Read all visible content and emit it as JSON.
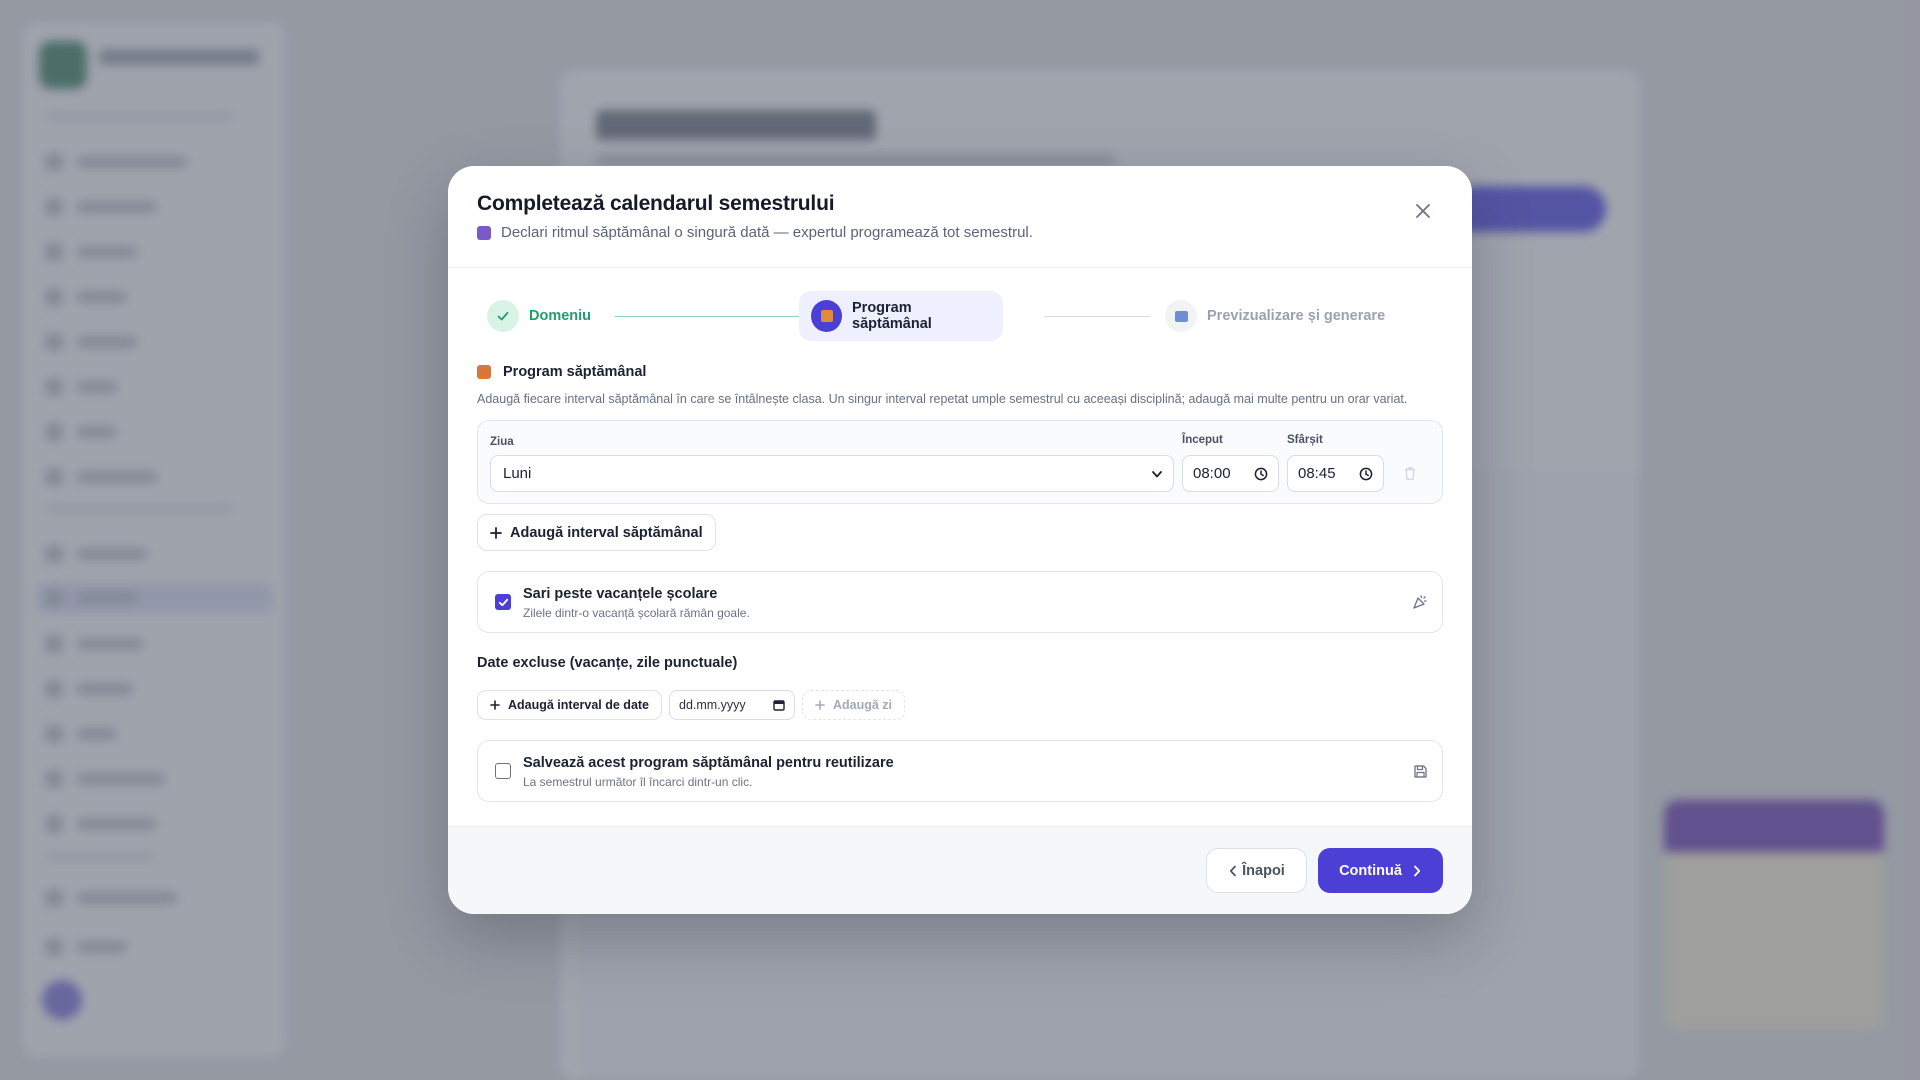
{
  "modal": {
    "title": "Completează calendarul semestrului",
    "subtitle": "Declari ritmul săptămânal o singură dată — expertul programează tot semestrul."
  },
  "stepper": {
    "steps": [
      {
        "label": "Domeniu",
        "state": "done"
      },
      {
        "label": "Program săptămânal",
        "state": "current"
      },
      {
        "label": "Previzualizare și generare",
        "state": "todo"
      }
    ]
  },
  "weekly": {
    "heading": "Program săptămânal",
    "description": "Adaugă fiecare interval săptămânal în care se întâlnește clasa. Un singur interval repetat umple semestrul cu aceeași disciplină; adaugă mai multe pentru un orar variat.",
    "day_label": "Ziua",
    "day_value": "Luni",
    "start_label": "Început",
    "start_value": "08:00",
    "end_label": "Sfârșit",
    "end_value": "08:45",
    "add_interval_label": "Adaugă interval săptămânal"
  },
  "vacations": {
    "title": "Sari peste vacanțele școlare",
    "description": "Zilele dintr-o vacanță școlară rămân goale.",
    "checked": true
  },
  "excluded": {
    "title": "Date excluse (vacanțe, zile punctuale)",
    "add_range_label": "Adaugă interval de date",
    "date_placeholder": "dd.mm.yyyy",
    "add_day_label": "Adaugă zi"
  },
  "save_program": {
    "title": "Salvează acest program săptămânal pentru reutilizare",
    "description": "La semestrul următor îl încarci dintr-un clic.",
    "checked": false
  },
  "footer": {
    "back_label": "Înapoi",
    "continue_label": "Continuă"
  },
  "colors": {
    "accent": "#4c3fd6",
    "success": "#1f9d6a"
  }
}
